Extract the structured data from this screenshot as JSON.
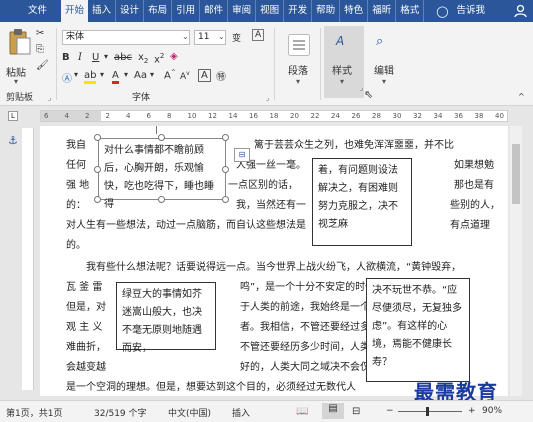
{
  "tabs": {
    "file": "文件",
    "items": [
      "开始",
      "插入",
      "设计",
      "布局",
      "引用",
      "邮件",
      "审阅",
      "视图",
      "开发",
      "帮助",
      "特色",
      "福昕",
      "格式"
    ],
    "active_index": 0,
    "tell_me": "告诉我"
  },
  "ribbon": {
    "clipboard_label": "剪贴板",
    "paste_label": "粘贴",
    "font_label": "字体",
    "font_name": "宋体",
    "font_size": "11",
    "paragraph_label": "段落",
    "styles_label": "样式",
    "editing_label": "编辑",
    "pinyin_label": "变"
  },
  "ruler": {
    "numbers": [
      "6",
      "4",
      "2",
      "2",
      "4",
      "6",
      "8",
      "10",
      "12",
      "14",
      "16",
      "18",
      "20",
      "22",
      "24",
      "26",
      "28",
      "30",
      "32",
      "34",
      "36",
      "38",
      "40"
    ]
  },
  "document": {
    "lines": [
      {
        "id": "l1a",
        "text": "我自"
      },
      {
        "id": "l1b",
        "text": "篱于芸芸众生之列，也难免浑浑噩噩，并不比"
      },
      {
        "id": "l2a",
        "text": "任何"
      },
      {
        "id": "l2b",
        "text": "人强一丝一毫。"
      },
      {
        "id": "l2c",
        "text": "如果想勉"
      },
      {
        "id": "l3a",
        "text": "强 地"
      },
      {
        "id": "l3b",
        "text": "一点区别的话，"
      },
      {
        "id": "l3c",
        "text": "那也是有"
      },
      {
        "id": "l4a",
        "text": "的："
      },
      {
        "id": "l4b",
        "text": "我，当然还有一"
      },
      {
        "id": "l4c",
        "text": "些别的人，"
      },
      {
        "id": "l5a",
        "text": "对人生有一些想法，动过一点脑筋，而自认这些想法是"
      },
      {
        "id": "l5b",
        "text": "有点道理"
      },
      {
        "id": "l6",
        "text": "的。"
      },
      {
        "id": "l7",
        "text": "我有些什么想法呢？话要说得远一点。当今世界上战火纷飞，人欲横流，“黄钟毁弃，"
      },
      {
        "id": "l8a",
        "text": "瓦 釜 雷"
      },
      {
        "id": "l8b",
        "text": "鸣”，是一个十分不安定的时代。"
      },
      {
        "id": "l9a",
        "text": "但是，对"
      },
      {
        "id": "l9b",
        "text": "于人类的前途，我始终是一个乐"
      },
      {
        "id": "l10a",
        "text": "观 主 义"
      },
      {
        "id": "l10b",
        "text": "者。我相信，不管还要经过多少艰"
      },
      {
        "id": "l11a",
        "text": "难曲折，"
      },
      {
        "id": "l11b",
        "text": "不管还要经历多少时间，人类总"
      },
      {
        "id": "l12a",
        "text": "会越变越"
      },
      {
        "id": "l12b",
        "text": "好的，人类大同之域决不会仅仅"
      },
      {
        "id": "l13",
        "text": "是一个空洞的理想。但是，想要达到这个目的，必须经过无数代人"
      }
    ],
    "boxes": [
      {
        "id": "box1",
        "text": "对什么事情都不瞻前顾后，心胸开朗，乐观愉快，吃也吃得下，睡也睡得"
      },
      {
        "id": "box2",
        "text": "着，有问题则设法解决之，有困难则努力克服之，决不视芝麻"
      },
      {
        "id": "box3",
        "text": "绿豆大的事情如芥迷嵩山般大，也决不毫无原则地随遇而安，"
      },
      {
        "id": "box4",
        "text": "决不玩世不恭。“应尽便须尽，无复独多虑”。有这样的心境，焉能不健康长寿？"
      }
    ]
  },
  "status": {
    "page": "第1页，共1页",
    "words": "32/519 个字",
    "language": "中文(中国)",
    "mode": "插入",
    "zoom": "90%"
  },
  "watermark": "最需教育"
}
